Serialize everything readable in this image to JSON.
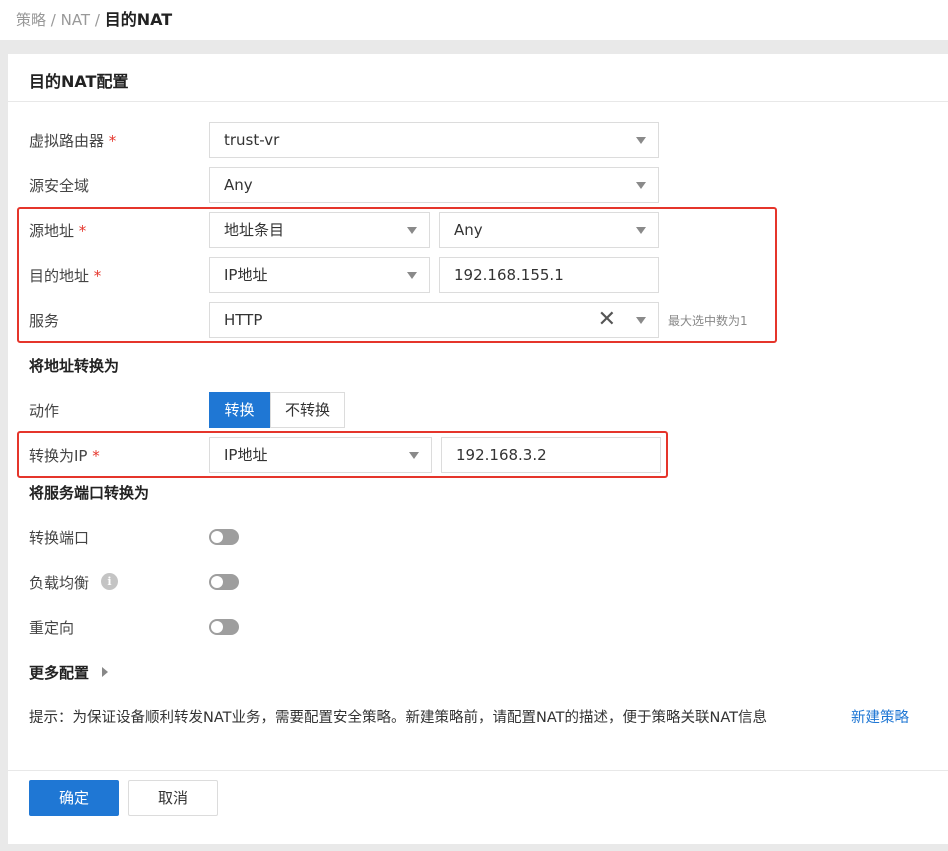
{
  "breadcrumb": {
    "item1": "策略",
    "sep": " / ",
    "item2": "NAT",
    "current": "目的NAT"
  },
  "card": {
    "title": "目的NAT配置"
  },
  "fields": {
    "virtual_router": {
      "label": "虚拟路由器",
      "required": "*",
      "value": "trust-vr"
    },
    "source_zone": {
      "label": "源安全域",
      "value": "Any"
    },
    "source_address": {
      "label": "源地址",
      "required": "*",
      "type_value": "地址条目",
      "value": "Any"
    },
    "dest_address": {
      "label": "目的地址",
      "required": "*",
      "type_value": "IP地址",
      "value": "192.168.155.1"
    },
    "service": {
      "label": "服务",
      "value": "HTTP",
      "clear": "✕",
      "max_hint": "最大选中数为1"
    }
  },
  "translate_section": {
    "title": "将地址转换为",
    "action": {
      "label": "动作",
      "options": [
        "转换",
        "不转换"
      ],
      "selected": "转换"
    },
    "translate_ip": {
      "label": "转换为IP",
      "required": "*",
      "type_value": "IP地址",
      "value": "192.168.3.2"
    }
  },
  "port_section": {
    "title": "将服务端口转换为",
    "translate_port": {
      "label": "转换端口",
      "on": false
    },
    "load_balance": {
      "label": "负载均衡",
      "info": "i",
      "on": false
    },
    "redirect": {
      "label": "重定向",
      "on": false
    }
  },
  "more_config": {
    "label": "更多配置"
  },
  "tip": {
    "text": "提示：为保证设备顺利转发NAT业务，需要配置安全策略。新建策略前，请配置NAT的描述，便于策略关联NAT信息",
    "link": "新建策略"
  },
  "buttons": {
    "ok": "确定",
    "cancel": "取消"
  },
  "colors": {
    "primary": "#1f77d4",
    "required": "#e5352b",
    "highlight_box": "#e5352b"
  }
}
